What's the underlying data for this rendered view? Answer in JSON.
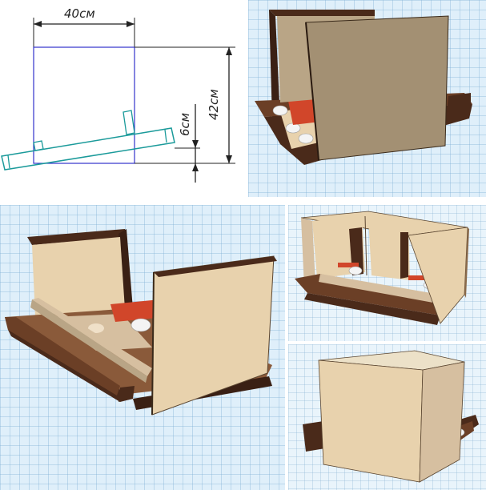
{
  "drawing": {
    "width_label": "40см",
    "height_label": "42см",
    "tilt_label": "6см"
  },
  "colors": {
    "frame_blue": "#3333cc",
    "tray_teal": "#1a9a9a",
    "dim_line": "#222222",
    "panel_beige": "#e8d2ad",
    "panel_taupe": "#a39073",
    "wood_dark": "#4a2a1a",
    "wood_mid": "#8a5a3a",
    "accent_red": "#d1462a",
    "egg_white": "#f4f4f4"
  }
}
